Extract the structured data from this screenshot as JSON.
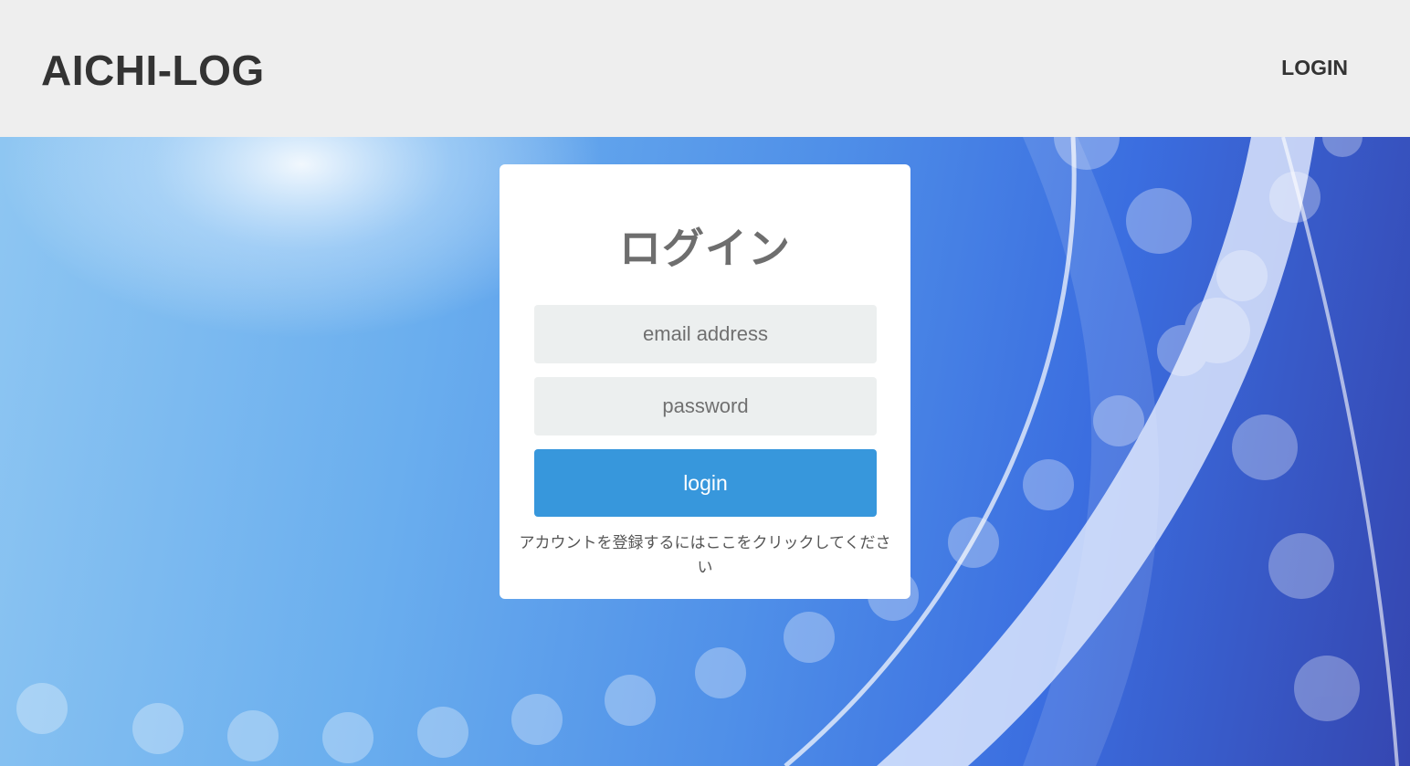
{
  "header": {
    "brand": "AICHI-LOG",
    "nav_login": "LOGIN"
  },
  "login_card": {
    "title": "ログイン",
    "email_placeholder": "email address",
    "password_placeholder": "password",
    "login_button": "login",
    "register_link": "アカウントを登録するにはここをクリックしてください"
  },
  "colors": {
    "header_bg": "#eeeeee",
    "button_bg": "#3797dc",
    "input_bg": "#ecefef"
  },
  "icons": [
    "hero-background-decoration"
  ]
}
